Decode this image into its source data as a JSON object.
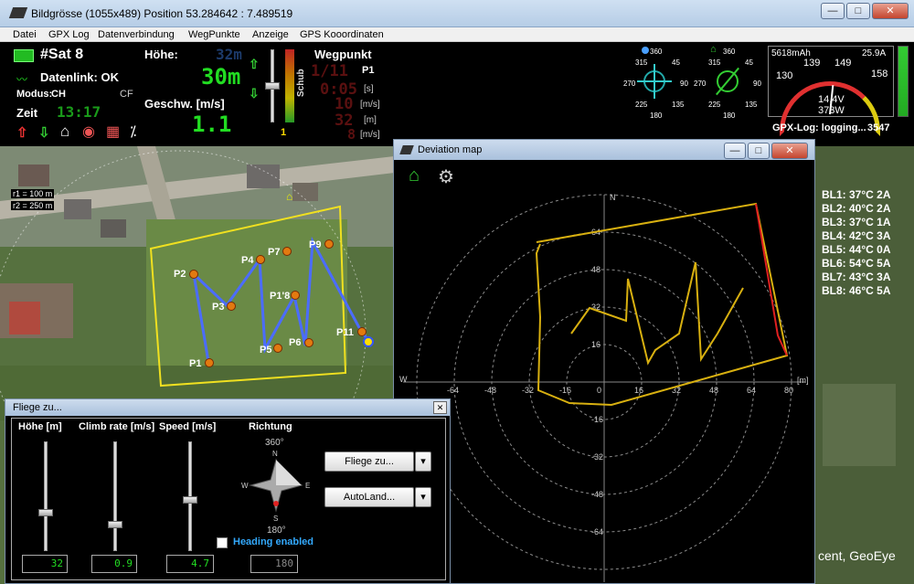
{
  "window": {
    "title": "Bildgrösse (1055x489) Position 53.284642 : 7.489519",
    "min": "—",
    "max": "□",
    "close": "✕"
  },
  "menu": [
    "Datei",
    "GPX Log",
    "Datenverbindung",
    "WegPunkte",
    "Anzeige",
    "GPS Kooordinaten"
  ],
  "dash": {
    "sat": "#Sat 8",
    "datalink": "Datenlink: OK",
    "modus_label": "Modus:",
    "modus_value": "CH",
    "modus_right": "CF",
    "zeit_label": "Zeit",
    "zeit_value": "13:17",
    "hoehe_label": "Höhe:",
    "hoehe_dim": "32m",
    "hoehe_value": "30m",
    "geschw_label": "Geschw. [m/s]",
    "geschw_value": "1.1",
    "schub_label": "Schub",
    "schub_value": "1",
    "wegpunkt_label": "Wegpunkt",
    "wp_count": "1/11",
    "wp_name": "P1",
    "wp_time": "0:05",
    "wp_time_unit": "[s]",
    "wp_speed": "10",
    "wp_speed_unit": "[m/s]",
    "wp_dist": "32",
    "wp_dist_unit": "[m]",
    "wp_dist2": "8",
    "wp_dist2_unit": "[m/s]",
    "compass1": {
      "n": "360",
      "ne": "45",
      "e": "90",
      "se": "135",
      "s": "180",
      "sw": "225",
      "w": "270",
      "nw": "315"
    },
    "compass2": {
      "n": "360",
      "ne": "45",
      "e": "90",
      "se": "135",
      "s": "180",
      "sw": "225",
      "w": "270",
      "nw": "315"
    },
    "battery": {
      "mah": "5618mAh",
      "amps": "25.9A",
      "s1": "139",
      "s2": "149",
      "s3": "158",
      "s0": "130",
      "volt": "14.4V",
      "watt": "373W"
    },
    "gpx_log": "GPX-Log: logging...",
    "gpx_count": "3547"
  },
  "map": {
    "scale1": "r1 = 100 m",
    "scale2": "r2 = 250 m",
    "waypoints": [
      "P1",
      "P2",
      "P3",
      "P4",
      "P5",
      "P6",
      "P7",
      "P1'8",
      "P9",
      "P11"
    ],
    "attribution": "cent, GeoEye"
  },
  "bl_values": [
    "BL1: 37°C  2A",
    "BL2: 40°C  2A",
    "BL3: 37°C  1A",
    "BL4: 42°C  3A",
    "BL5: 44°C  0A",
    "BL6: 54°C  5A",
    "BL7: 43°C  3A",
    "BL8: 46°C  5A"
  ],
  "deviation": {
    "title": "Deviation map",
    "north": "N",
    "west": "W",
    "unit": "[m]",
    "x_ticks": [
      "-64",
      "-48",
      "-32",
      "-16",
      "0",
      "16",
      "32",
      "48",
      "64",
      "80"
    ],
    "y_ticks": [
      "64",
      "48",
      "32",
      "16",
      "0",
      "-16",
      "-32",
      "-48",
      "-64"
    ]
  },
  "fly": {
    "title": "Fliege zu...",
    "hoehe_label": "Höhe [m]",
    "climb_label": "Climb rate [m/s]",
    "speed_label": "Speed [m/s]",
    "richtung_label": "Richtung",
    "deg_top": "360°",
    "deg_bottom": "180°",
    "n": "N",
    "s": "S",
    "e": "E",
    "w": "W",
    "hoehe_value": "32",
    "climb_value": "0.9",
    "speed_value": "4.7",
    "heading_value": "180",
    "heading_label": "Heading enabled",
    "fly_button": "Fliege zu...",
    "autoland_button": "AutoLand...",
    "dropdown": "▾",
    "close": "✕",
    "sliders": {
      "hoehe": 0.34,
      "climb": 0.22,
      "speed": 0.46
    }
  },
  "colors": {
    "accent_green": "#22dd22",
    "track_yellow": "#d8b010",
    "track_red": "#e02020"
  }
}
